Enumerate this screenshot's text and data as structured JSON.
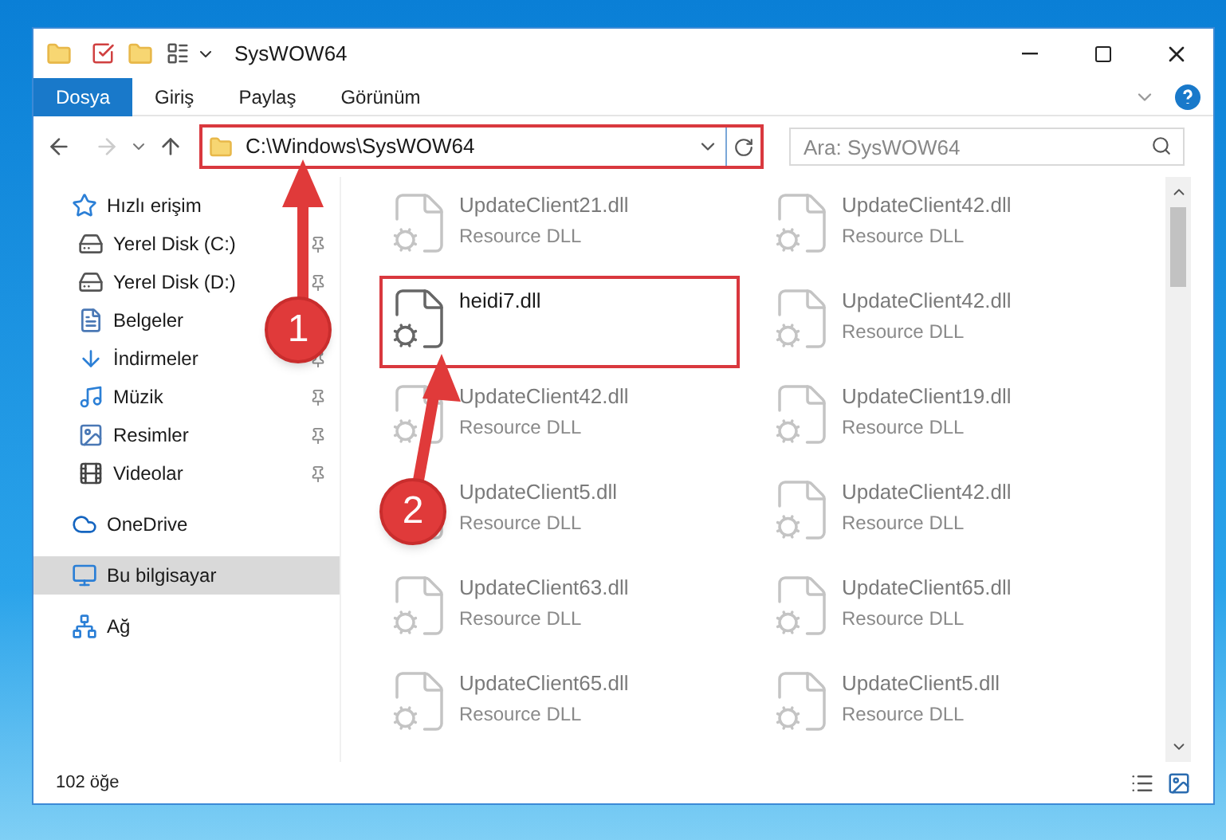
{
  "window": {
    "title": "SysWOW64"
  },
  "ribbon_tabs": [
    {
      "label": "Dosya",
      "selected": true
    },
    {
      "label": "Giriş",
      "selected": false
    },
    {
      "label": "Paylaş",
      "selected": false
    },
    {
      "label": "Görünüm",
      "selected": false
    }
  ],
  "address": {
    "value": "C:\\Windows\\SysWOW64"
  },
  "search": {
    "placeholder": "Ara: SysWOW64"
  },
  "sidebar": {
    "items": [
      {
        "label": "Hızlı erişim",
        "kind": "quick",
        "selected": false,
        "children": [
          {
            "label": "Yerel Disk (C:)",
            "kind": "disk",
            "pinned": true,
            "selected": false
          },
          {
            "label": "Yerel Disk (D:)",
            "kind": "disk",
            "pinned": true,
            "selected": false
          },
          {
            "label": "Belgeler",
            "kind": "docs",
            "selected": false
          },
          {
            "label": "İndirmeler",
            "kind": "download",
            "pinned": true,
            "selected": false
          },
          {
            "label": "Müzik",
            "kind": "music",
            "pinned": true,
            "selected": false
          },
          {
            "label": "Resimler",
            "kind": "pictures",
            "pinned": true,
            "selected": false
          },
          {
            "label": "Videolar",
            "kind": "videos",
            "pinned": true,
            "selected": false
          }
        ]
      },
      {
        "label": "OneDrive",
        "kind": "cloud",
        "selected": false
      },
      {
        "label": "Bu bilgisayar",
        "kind": "pc",
        "selected": true
      },
      {
        "label": "Ağ",
        "kind": "network",
        "selected": false
      }
    ]
  },
  "files": [
    {
      "name": "UpdateClient21.dll",
      "type": "Resource DLL",
      "blurred": true
    },
    {
      "name": "UpdateClient42.dll",
      "type": "Resource DLL",
      "blurred": true
    },
    {
      "name": "heidi7.dll",
      "blurred": false,
      "highlighted": true
    },
    {
      "name": "UpdateClient42.dll",
      "type": "Resource DLL",
      "blurred": true
    },
    {
      "name": "UpdateClient42.dll",
      "type": "Resource DLL",
      "blurred": true
    },
    {
      "name": "UpdateClient19.dll",
      "type": "Resource DLL",
      "blurred": true
    },
    {
      "name": "UpdateClient5.dll",
      "type": "Resource DLL",
      "blurred": true
    },
    {
      "name": "UpdateClient42.dll",
      "type": "Resource DLL",
      "blurred": true
    },
    {
      "name": "UpdateClient63.dll",
      "type": "Resource DLL",
      "blurred": true
    },
    {
      "name": "UpdateClient65.dll",
      "type": "Resource DLL",
      "blurred": true
    },
    {
      "name": "UpdateClient65.dll",
      "type": "Resource DLL",
      "blurred": true
    },
    {
      "name": "UpdateClient5.dll",
      "type": "Resource DLL",
      "blurred": true
    }
  ],
  "status_bar": {
    "count": "102 öğe"
  },
  "callouts": [
    {
      "number": "1"
    },
    {
      "number": "2"
    }
  ]
}
